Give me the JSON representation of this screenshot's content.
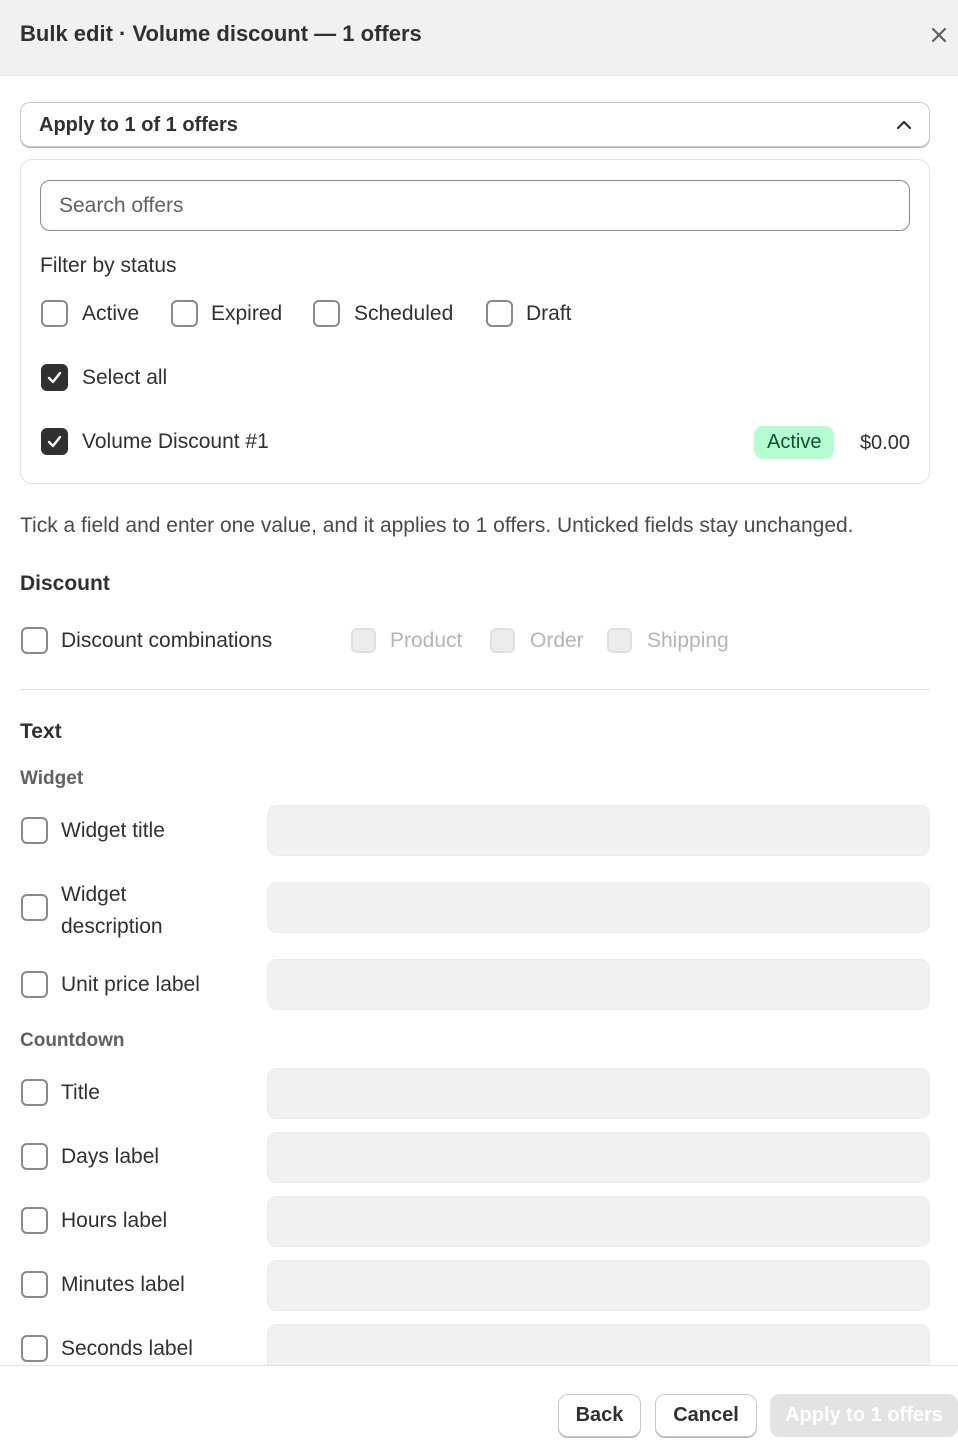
{
  "header": {
    "title": "Bulk edit · Volume discount — 1 offers",
    "close_icon": "close-icon"
  },
  "apply_toggle": {
    "label": "Apply to 1 of 1 offers",
    "icon": "chevron-up-icon"
  },
  "search": {
    "placeholder": "Search offers",
    "value": ""
  },
  "filter": {
    "label": "Filter by status",
    "statuses": [
      {
        "label": "Active",
        "checked": false
      },
      {
        "label": "Expired",
        "checked": false
      },
      {
        "label": "Scheduled",
        "checked": false
      },
      {
        "label": "Draft",
        "checked": false
      }
    ]
  },
  "select_all": {
    "label": "Select all",
    "checked": true
  },
  "offers": [
    {
      "name": "Volume Discount #1",
      "checked": true,
      "status": "Active",
      "price": "$0.00"
    }
  ],
  "helper_text": "Tick a field and enter one value, and it applies to 1 offers. Unticked fields stay unchanged.",
  "discount": {
    "title": "Discount",
    "combinations_label": "Discount combinations",
    "options": [
      {
        "label": "Product",
        "disabled": true
      },
      {
        "label": "Order",
        "disabled": true
      },
      {
        "label": "Shipping",
        "disabled": true
      }
    ]
  },
  "text": {
    "title": "Text",
    "widget": {
      "title": "Widget",
      "fields": [
        {
          "label": "Widget title",
          "value": ""
        },
        {
          "label": "Widget description",
          "value": ""
        },
        {
          "label": "Unit price label",
          "value": ""
        }
      ]
    },
    "countdown": {
      "title": "Countdown",
      "fields": [
        {
          "label": "Title",
          "value": ""
        },
        {
          "label": "Days label",
          "value": ""
        },
        {
          "label": "Hours label",
          "value": ""
        },
        {
          "label": "Minutes label",
          "value": ""
        },
        {
          "label": "Seconds label",
          "value": ""
        }
      ]
    }
  },
  "footer": {
    "back_label": "Back",
    "cancel_label": "Cancel",
    "apply_label": "Apply to 1 offers"
  },
  "colors": {
    "badge_bg": "#b4fed2",
    "badge_text": "#0c5132",
    "checked_bg": "#303030",
    "disabled_button_bg": "#e3e3e3"
  }
}
